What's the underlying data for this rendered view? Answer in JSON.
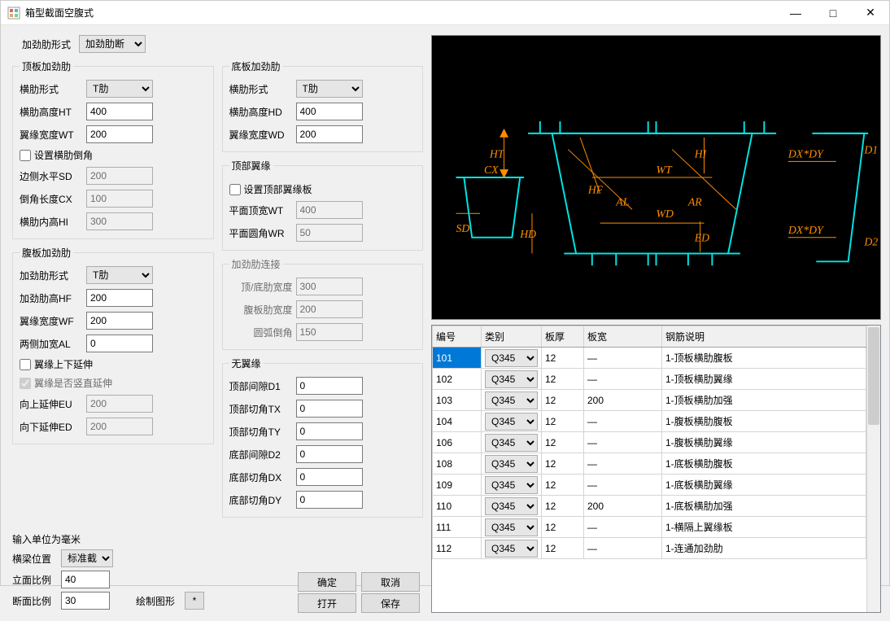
{
  "window": {
    "title": "箱型截面空腹式"
  },
  "top": {
    "label": "加劲肋形式",
    "value": "加劲肋断"
  },
  "groups": {
    "top_plate": {
      "legend": "顶板加劲肋",
      "form_label": "横肋形式",
      "form_value": "T肋",
      "ht_label": "横肋高度HT",
      "ht_value": "400",
      "wt_label": "翼缘宽度WT",
      "wt_value": "200",
      "chamfer_chk": "设置横肋倒角",
      "sd_label": "边侧水平SD",
      "sd_value": "200",
      "cx_label": "倒角长度CX",
      "cx_value": "100",
      "hi_label": "横肋内高HI",
      "hi_value": "300"
    },
    "web_plate": {
      "legend": "腹板加劲肋",
      "form_label": "加劲肋形式",
      "form_value": "T肋",
      "hf_label": "加劲肋高HF",
      "hf_value": "200",
      "wf_label": "翼缘宽度WF",
      "wf_value": "200",
      "al_label": "两侧加宽AL",
      "al_value": "0",
      "ext_chk": "翼缘上下延伸",
      "vert_chk": "翼缘是否竖直延伸",
      "eu_label": "向上延伸EU",
      "eu_value": "200",
      "ed_label": "向下延伸ED",
      "ed_value": "200"
    },
    "bottom_plate": {
      "legend": "底板加劲肋",
      "form_label": "横肋形式",
      "form_value": "T肋",
      "hd_label": "横肋高度HD",
      "hd_value": "400",
      "wd_label": "翼缘宽度WD",
      "wd_value": "200"
    },
    "top_flange": {
      "legend": "顶部翼缘",
      "chk": "设置顶部翼缘板",
      "wt_label": "平面顶宽WT",
      "wt_value": "400",
      "wr_label": "平面圆角WR",
      "wr_value": "50"
    },
    "link": {
      "legend": "加劲肋连接",
      "tb_label": "顶/底肋宽度",
      "tb_value": "300",
      "web_label": "腹板肋宽度",
      "web_value": "200",
      "arc_label": "圆弧倒角",
      "arc_value": "150"
    },
    "no_flange": {
      "legend": "无翼缘",
      "d1_label": "顶部间隙D1",
      "d1_value": "0",
      "tx_label": "顶部切角TX",
      "tx_value": "0",
      "ty_label": "顶部切角TY",
      "ty_value": "0",
      "d2_label": "底部间隙D2",
      "d2_value": "0",
      "dx_label": "底部切角DX",
      "dx_value": "0",
      "dy_label": "底部切角DY",
      "dy_value": "0"
    }
  },
  "bottom": {
    "unit_label": "输入单位为毫米",
    "pos_label": "横梁位置",
    "pos_value": "标准截",
    "elev_label": "立面比例",
    "elev_value": "40",
    "sec_label": "断面比例",
    "sec_value": "30",
    "draw_label": "绘制图形",
    "star": "*"
  },
  "buttons": {
    "ok": "确定",
    "cancel": "取消",
    "open": "打开",
    "save": "保存"
  },
  "diagram_labels": {
    "ht": "HT",
    "cx": "CX",
    "sd": "SD",
    "hd": "HD",
    "hf": "HF",
    "wt": "WT",
    "al": "AL",
    "wd": "WD",
    "ar": "AR",
    "ed": "ED",
    "dxdy1": "DX*DY",
    "dxdy2": "DX*DY",
    "d1": "D1",
    "d2": "D2",
    "hi": "HI"
  },
  "table": {
    "headers": {
      "id": "编号",
      "cat": "类别",
      "thick": "板厚",
      "width": "板宽",
      "desc": "钢筋说明"
    },
    "rows": [
      {
        "id": "101",
        "cat": "Q345",
        "thick": "12",
        "width": "—",
        "desc": "1-顶板横肋腹板"
      },
      {
        "id": "102",
        "cat": "Q345",
        "thick": "12",
        "width": "—",
        "desc": "1-顶板横肋翼缘"
      },
      {
        "id": "103",
        "cat": "Q345",
        "thick": "12",
        "width": "200",
        "desc": "1-顶板横肋加强"
      },
      {
        "id": "104",
        "cat": "Q345",
        "thick": "12",
        "width": "—",
        "desc": "1-腹板横肋腹板"
      },
      {
        "id": "106",
        "cat": "Q345",
        "thick": "12",
        "width": "—",
        "desc": "1-腹板横肋翼缘"
      },
      {
        "id": "108",
        "cat": "Q345",
        "thick": "12",
        "width": "—",
        "desc": "1-底板横肋腹板"
      },
      {
        "id": "109",
        "cat": "Q345",
        "thick": "12",
        "width": "—",
        "desc": "1-底板横肋翼缘"
      },
      {
        "id": "110",
        "cat": "Q345",
        "thick": "12",
        "width": "200",
        "desc": "1-底板横肋加强"
      },
      {
        "id": "111",
        "cat": "Q345",
        "thick": "12",
        "width": "—",
        "desc": "1-横隔上翼缘板"
      },
      {
        "id": "112",
        "cat": "Q345",
        "thick": "12",
        "width": "—",
        "desc": "1-连通加劲肋"
      }
    ]
  }
}
